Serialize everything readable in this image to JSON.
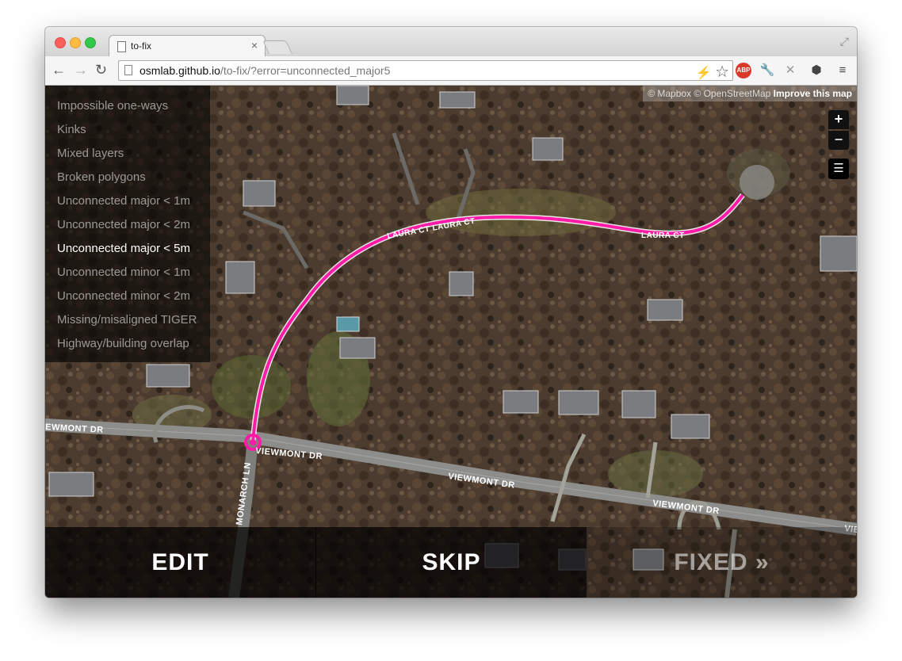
{
  "browser": {
    "tab_title": "to-fix",
    "tab_close": "×",
    "url_host": "osmlab.github.io",
    "url_path": "/to-fix/?error=unconnected_major5",
    "nav_back": "←",
    "nav_forward": "→",
    "nav_reload": "↻",
    "star": "☆",
    "abp": "ABP",
    "menu": "≡"
  },
  "map": {
    "attribution_prefix": "© Mapbox © OpenStreetMap ",
    "attribution_link": "Improve this map",
    "zoom_in": "+",
    "zoom_out": "−",
    "street_labels": [
      "EWMONT DR",
      "VIEWMONT DR",
      "VIEWMONT DR",
      "VIEWMONT DR",
      "VIE",
      "MONARCH LN",
      "LAURA CT LAURA CT",
      "LAURA CT"
    ]
  },
  "sidebar": {
    "items": [
      {
        "label": "Impossible one-ways",
        "active": false
      },
      {
        "label": "Kinks",
        "active": false
      },
      {
        "label": "Mixed layers",
        "active": false
      },
      {
        "label": "Broken polygons",
        "active": false
      },
      {
        "label": "Unconnected major < 1m",
        "active": false
      },
      {
        "label": "Unconnected major < 2m",
        "active": false
      },
      {
        "label": "Unconnected major < 5m",
        "active": true
      },
      {
        "label": "Unconnected minor < 1m",
        "active": false
      },
      {
        "label": "Unconnected minor < 2m",
        "active": false
      },
      {
        "label": "Missing/misaligned TIGER",
        "active": false
      },
      {
        "label": "Highway/building overlap",
        "active": false
      }
    ]
  },
  "actions": {
    "edit": "EDIT",
    "skip": "SKIP",
    "fixed": "FIXED »"
  },
  "colors": {
    "highlight": "#ff1aa8",
    "panel": "#000000"
  }
}
